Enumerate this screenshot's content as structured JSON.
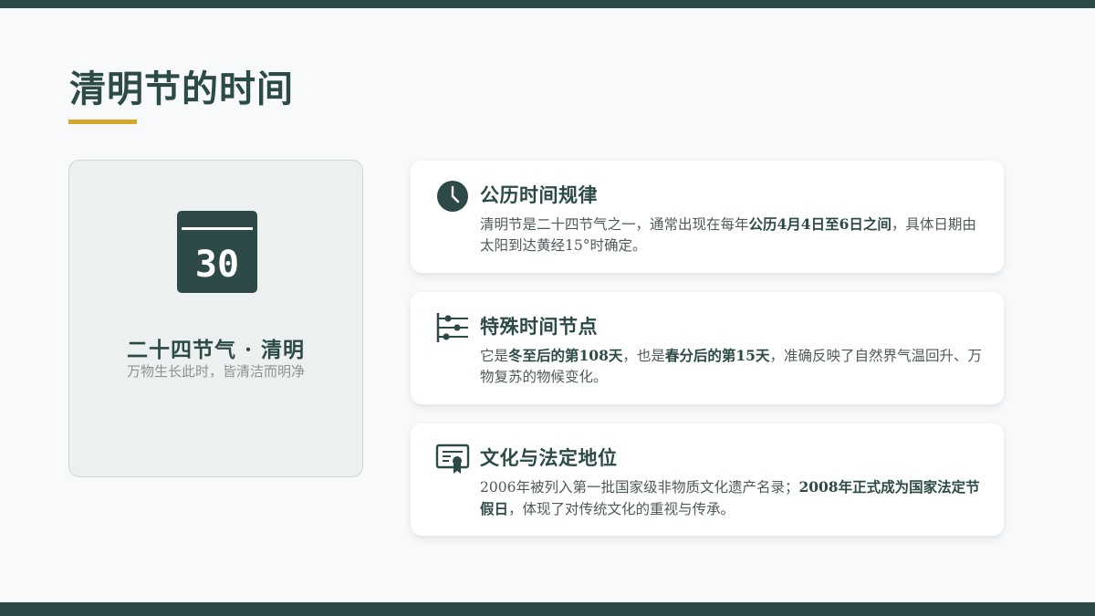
{
  "page": {
    "title": "清明节的时间"
  },
  "colors": {
    "primary": "#2d4a48",
    "accent": "#d4a62a",
    "background": "#f8f9fb",
    "card_bg": "#ffffff",
    "left_card_bg": "#edf0f0"
  },
  "left_card": {
    "icon": "calendar-icon",
    "calendar_number": "30",
    "title": "二十四节气 · 清明",
    "subtitle": "万物生长此时，皆清洁而明净"
  },
  "cards": [
    {
      "icon": "clock-icon",
      "title": "公历时间规律",
      "body": [
        {
          "text": "清明节是二十四节气之一，通常出现在每年",
          "bold": false
        },
        {
          "text": "公历4月4日至6日之间",
          "bold": true
        },
        {
          "text": "，具体日期由太阳到达黄经15°时确定。",
          "bold": false
        }
      ]
    },
    {
      "icon": "timeline-icon",
      "title": "特殊时间节点",
      "body": [
        {
          "text": "它是",
          "bold": false
        },
        {
          "text": "冬至后的第108天",
          "bold": true
        },
        {
          "text": "，也是",
          "bold": false
        },
        {
          "text": "春分后的第15天",
          "bold": true
        },
        {
          "text": "，准确反映了自然界气温回升、万物复苏的物候变化。",
          "bold": false
        }
      ]
    },
    {
      "icon": "certificate-icon",
      "title": "文化与法定地位",
      "body": [
        {
          "text": "2006年被列入第一批国家级非物质文化遗产名录；",
          "bold": false
        },
        {
          "text": "2008年正式成为国家法定节假日",
          "bold": true
        },
        {
          "text": "，体现了对传统文化的重视与传承。",
          "bold": false
        }
      ]
    }
  ]
}
